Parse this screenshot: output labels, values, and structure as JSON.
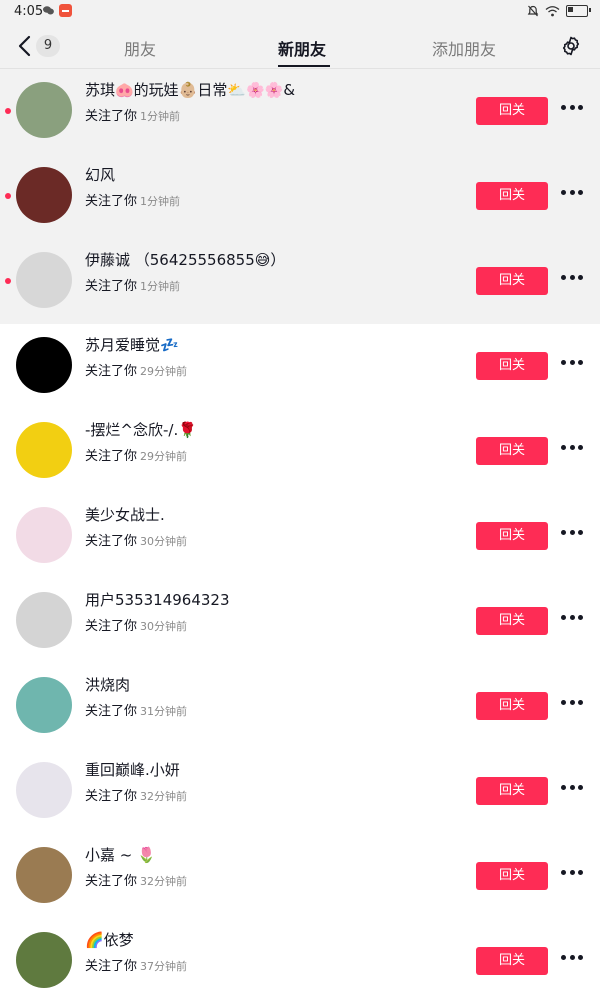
{
  "status_bar": {
    "time": "4:05"
  },
  "header": {
    "back_count": "9",
    "tabs": [
      {
        "label": "朋友"
      },
      {
        "label": "新朋友"
      },
      {
        "label": "添加朋友"
      }
    ]
  },
  "follow_button_label": "回关",
  "rows": [
    {
      "name": "苏琪🐽的玩娃👶🏼日常⛅🌸🌸&",
      "action": "关注了你",
      "time": "1分钟前",
      "unread": true,
      "avatar_color": "#8aa07e"
    },
    {
      "name": "幻风",
      "action": "关注了你",
      "time": "1分钟前",
      "unread": true,
      "avatar_color": "#6b2a26"
    },
    {
      "name": "伊藤诚 （56425556855😅）",
      "action": "关注了你",
      "time": "1分钟前",
      "unread": true,
      "avatar_color": "#d7d7d7"
    },
    {
      "name": "苏月爱睡觉💤",
      "action": "关注了你",
      "time": "29分钟前",
      "unread": false,
      "avatar_color": "#000000"
    },
    {
      "name": "-摆烂^念欣-/.🌹",
      "action": "关注了你",
      "time": "29分钟前",
      "unread": false,
      "avatar_color": "#f2cf12"
    },
    {
      "name": "美少女战士.",
      "action": "关注了你",
      "time": "30分钟前",
      "unread": false,
      "avatar_color": "#f2dbe6"
    },
    {
      "name": "用户535314964323",
      "action": "关注了你",
      "time": "30分钟前",
      "unread": false,
      "avatar_color": "#d4d4d4"
    },
    {
      "name": "洪烧肉",
      "action": "关注了你",
      "time": "31分钟前",
      "unread": false,
      "avatar_color": "#6fb6ae"
    },
    {
      "name": "重回巅峰.小妍",
      "action": "关注了你",
      "time": "32分钟前",
      "unread": false,
      "avatar_color": "#e7e4ec"
    },
    {
      "name": "小嘉 ~ 🌷",
      "action": "关注了你",
      "time": "32分钟前",
      "unread": false,
      "avatar_color": "#9a7b52"
    },
    {
      "name": "🌈依梦",
      "action": "关注了你",
      "time": "37分钟前",
      "unread": false,
      "avatar_color": "#5f7a3f"
    }
  ],
  "colors": {
    "accent": "#fe2c55",
    "unread_background": "#f2f2f2"
  }
}
